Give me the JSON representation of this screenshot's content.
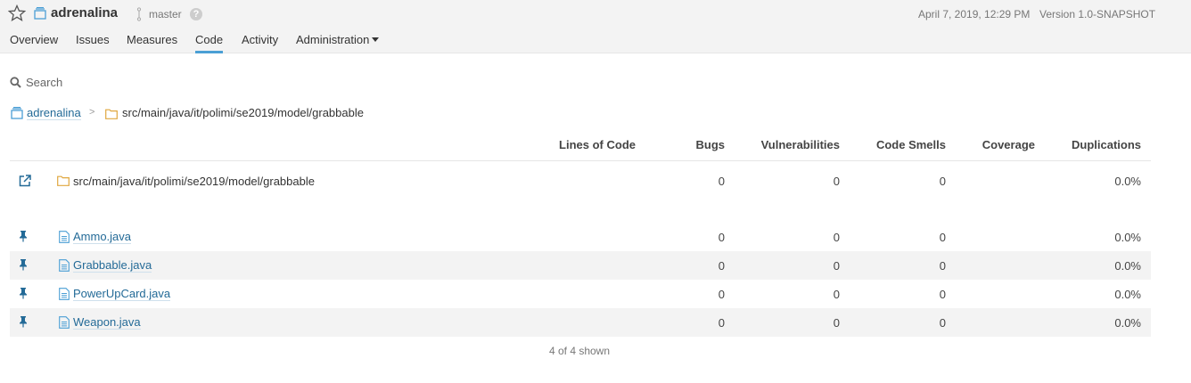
{
  "header": {
    "project_name": "adrenalina",
    "branch": "master",
    "help": "?",
    "date": "April 7, 2019, 12:29 PM",
    "version": "Version 1.0-SNAPSHOT"
  },
  "nav": {
    "items": [
      {
        "label": "Overview",
        "active": false
      },
      {
        "label": "Issues",
        "active": false
      },
      {
        "label": "Measures",
        "active": false
      },
      {
        "label": "Code",
        "active": true
      },
      {
        "label": "Activity",
        "active": false
      },
      {
        "label": "Administration",
        "active": false
      }
    ]
  },
  "search": {
    "placeholder": "Search"
  },
  "breadcrumb": {
    "project": "adrenalina",
    "separator": ">",
    "path": "src/main/java/it/polimi/se2019/model/grabbable"
  },
  "table": {
    "columns": [
      "Lines of Code",
      "Bugs",
      "Vulnerabilities",
      "Code Smells",
      "Coverage",
      "Duplications"
    ],
    "base_row": {
      "name": "src/main/java/it/polimi/se2019/model/grabbable",
      "lines": "",
      "bugs": "0",
      "vulnerabilities": "0",
      "code_smells": "0",
      "coverage": "",
      "duplications": "0.0%"
    },
    "rows": [
      {
        "name": "Ammo.java",
        "lines": "",
        "bugs": "0",
        "vulnerabilities": "0",
        "code_smells": "0",
        "coverage": "",
        "duplications": "0.0%"
      },
      {
        "name": "Grabbable.java",
        "lines": "",
        "bugs": "0",
        "vulnerabilities": "0",
        "code_smells": "0",
        "coverage": "",
        "duplications": "0.0%"
      },
      {
        "name": "PowerUpCard.java",
        "lines": "",
        "bugs": "0",
        "vulnerabilities": "0",
        "code_smells": "0",
        "coverage": "",
        "duplications": "0.0%"
      },
      {
        "name": "Weapon.java",
        "lines": "",
        "bugs": "0",
        "vulnerabilities": "0",
        "code_smells": "0",
        "coverage": "",
        "duplications": "0.0%"
      }
    ]
  },
  "footer": {
    "count_text": "4 of 4 shown"
  },
  "colors": {
    "link": "#236a97",
    "accent": "#4b9fd5",
    "folder": "#e0a73f",
    "icon_blue": "#236a97",
    "topbar_bg": "#f3f3f3",
    "row_alt_bg": "#f3f3f3"
  }
}
